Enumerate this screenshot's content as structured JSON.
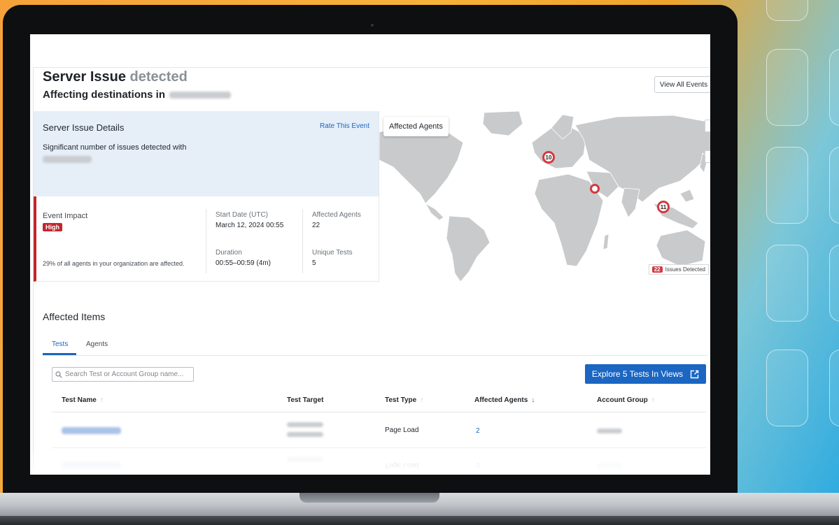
{
  "header": {
    "title_main": "Server Issue",
    "title_muted": "detected",
    "subtitle": "Affecting destinations in",
    "view_all_label": "View All Events"
  },
  "details": {
    "title": "Server Issue Details",
    "rate_label": "Rate This Event",
    "description": "Significant number of issues detected with"
  },
  "impact": {
    "label": "Event Impact",
    "level": "High",
    "note": "29% of all agents in your organization are affected.",
    "start_label": "Start Date (UTC)",
    "start_value": "March 12, 2024 00:55",
    "duration_label": "Duration",
    "duration_value": "00:55–00:59 (4m)",
    "agents_label": "Affected Agents",
    "agents_value": "22",
    "tests_label": "Unique Tests",
    "tests_value": "5"
  },
  "map": {
    "label": "Affected Agents",
    "markers": [
      {
        "name": "europe",
        "count": "10"
      },
      {
        "name": "middle-east",
        "count": ""
      },
      {
        "name": "southeast-asia",
        "count": "11"
      }
    ],
    "issues_count": "22",
    "issues_label": "Issues Detected"
  },
  "affected": {
    "title": "Affected Items",
    "tabs": [
      {
        "label": "Tests",
        "active": true
      },
      {
        "label": "Agents",
        "active": false
      }
    ],
    "search_placeholder": "Search Test or Account Group name...",
    "explore_label": "Explore 5 Tests In Views",
    "columns": [
      "Test Name",
      "Test Target",
      "Test Type",
      "Affected Agents",
      "Account Group"
    ],
    "rows": [
      {
        "test_type": "Page Load",
        "affected_agents": "2"
      },
      {
        "test_type": "Page Load",
        "affected_agents": "3"
      }
    ]
  },
  "colors": {
    "accent": "#1a66c2",
    "danger": "#c0272d",
    "details_bg": "#e6eef8"
  }
}
